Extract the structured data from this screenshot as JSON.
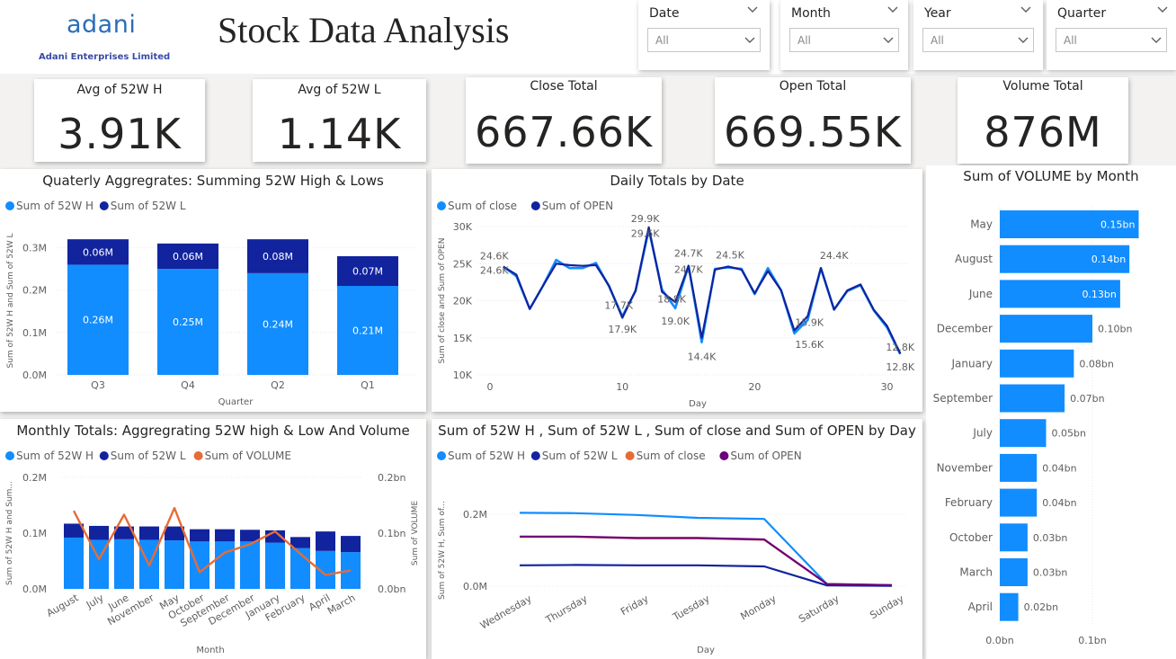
{
  "header": {
    "logo_word": "adani",
    "logo_sub": "Adani Enterprises Limited",
    "title": "Stock Data Analysis"
  },
  "slicers": [
    {
      "name": "Date",
      "value": "All"
    },
    {
      "name": "Month",
      "value": "All"
    },
    {
      "name": "Year",
      "value": "All"
    },
    {
      "name": "Quarter",
      "value": "All"
    }
  ],
  "kpis": [
    {
      "label": "Avg of 52W H",
      "value": "3.91K"
    },
    {
      "label": "Avg of 52W L",
      "value": "1.14K"
    },
    {
      "label": "Close Total",
      "value": "667.66K"
    },
    {
      "label": "Open Total",
      "value": "669.55K"
    },
    {
      "label": "Volume Total",
      "value": "876M"
    }
  ],
  "colors": {
    "light_blue": "#118dff",
    "dark_blue": "#12239e",
    "orange": "#e66c37",
    "purple": "#6b007b",
    "grid": "#e8e8e8",
    "axis_text": "#605e5c"
  },
  "chart_data": [
    {
      "id": "quarterly",
      "type": "bar",
      "title": "Quaterly Aggregrates: Summing 52W High & Lows",
      "legend": [
        "Sum of 52W H",
        "Sum of 52W L"
      ],
      "xlabel": "Quarter",
      "ylabel": "Sum of 52W H and Sum of 52W L",
      "categories": [
        "Q3",
        "Q4",
        "Q2",
        "Q1"
      ],
      "series": [
        {
          "name": "Sum of 52W H",
          "values": [
            0.26,
            0.25,
            0.24,
            0.21
          ],
          "labels": [
            "0.26M",
            "0.25M",
            "0.24M",
            "0.21M"
          ]
        },
        {
          "name": "Sum of 52W L",
          "values": [
            0.06,
            0.06,
            0.08,
            0.07
          ],
          "labels": [
            "0.06M",
            "0.06M",
            "0.08M",
            "0.07M"
          ]
        }
      ],
      "ylim": [
        0,
        0.35
      ],
      "yticks": [
        0,
        0.1,
        0.2,
        0.3
      ],
      "ytick_labels": [
        "0.0M",
        "0.1M",
        "0.2M",
        "0.3M"
      ]
    },
    {
      "id": "daily",
      "type": "line",
      "title": "Daily Totals by Date",
      "legend": [
        "Sum of close",
        "Sum of OPEN"
      ],
      "xlabel": "Day",
      "ylabel": "Sum of close and Sum of OPEN",
      "x": [
        1,
        2,
        3,
        4,
        5,
        6,
        7,
        8,
        9,
        10,
        11,
        12,
        13,
        14,
        15,
        16,
        17,
        18,
        19,
        20,
        21,
        22,
        23,
        24,
        25,
        26,
        27,
        28,
        29,
        30,
        31
      ],
      "series": [
        {
          "name": "Sum of close",
          "values": [
            24.6,
            23.3,
            18.9,
            22.0,
            25.5,
            24.4,
            24.4,
            25.1,
            21.9,
            17.9,
            21.3,
            29.6,
            21.5,
            19.0,
            24.7,
            14.4,
            24.3,
            24.5,
            24.3,
            20.9,
            24.4,
            21.4,
            15.6,
            17.4,
            24.4,
            18.8,
            21.3,
            22.1,
            18.7,
            16.4,
            12.8
          ]
        },
        {
          "name": "Sum of OPEN",
          "values": [
            24.6,
            23.5,
            18.9,
            22.0,
            25.0,
            24.8,
            24.7,
            24.8,
            22.0,
            17.7,
            21.4,
            29.9,
            21.2,
            19.8,
            24.7,
            15.0,
            24.2,
            24.6,
            24.2,
            21.0,
            24.0,
            21.4,
            16.0,
            17.9,
            24.4,
            18.8,
            21.4,
            22.2,
            18.8,
            16.6,
            12.9
          ]
        }
      ],
      "annotations": [
        "24.6K",
        "24.6K",
        "17.7K",
        "17.9K",
        "29.9K",
        "29.6K",
        "18.8K",
        "19.0K",
        "24.7K",
        "24.7K",
        "14.4K",
        "24.5K",
        "15.9K",
        "15.6K",
        "24.4K",
        "12.8K",
        "12.8K"
      ],
      "xlim": [
        0,
        32
      ],
      "xticks": [
        0,
        10,
        20,
        30
      ],
      "ylim": [
        10,
        30
      ],
      "yticks": [
        10,
        15,
        20,
        25,
        30
      ],
      "ytick_labels": [
        "10K",
        "15K",
        "20K",
        "25K",
        "30K"
      ]
    },
    {
      "id": "volume_month",
      "type": "bar",
      "orientation": "horizontal",
      "title": "Sum of VOLUME by Month",
      "categories": [
        "May",
        "August",
        "June",
        "December",
        "January",
        "September",
        "July",
        "November",
        "February",
        "October",
        "March",
        "April"
      ],
      "values": [
        0.15,
        0.14,
        0.13,
        0.1,
        0.08,
        0.07,
        0.05,
        0.04,
        0.04,
        0.03,
        0.03,
        0.02
      ],
      "labels": [
        "0.15bn",
        "0.14bn",
        "0.13bn",
        "0.10bn",
        "0.08bn",
        "0.07bn",
        "0.05bn",
        "0.04bn",
        "0.04bn",
        "0.03bn",
        "0.03bn",
        "0.02bn"
      ],
      "xlim": [
        0,
        0.16
      ],
      "xticks": [
        0,
        0.1
      ],
      "xtick_labels": [
        "0.0bn",
        "0.1bn"
      ]
    },
    {
      "id": "monthly",
      "type": "bar",
      "title": "Monthly Totals: Aggregrating 52W high & Low And Volume",
      "legend": [
        "Sum of 52W H",
        "Sum of 52W L",
        "Sum of VOLUME"
      ],
      "xlabel": "Month",
      "ylabel": "Sum of 52W H and Sum...",
      "y2label": "Sum of VOLUME",
      "categories": [
        "August",
        "July",
        "June",
        "November",
        "May",
        "October",
        "September",
        "December",
        "January",
        "February",
        "April",
        "March"
      ],
      "series": [
        {
          "name": "Sum of 52W H",
          "values": [
            0.092,
            0.088,
            0.089,
            0.088,
            0.087,
            0.085,
            0.085,
            0.085,
            0.083,
            0.073,
            0.068,
            0.066
          ]
        },
        {
          "name": "Sum of 52W L",
          "values": [
            0.025,
            0.025,
            0.023,
            0.024,
            0.025,
            0.022,
            0.022,
            0.021,
            0.022,
            0.02,
            0.035,
            0.029
          ]
        },
        {
          "name": "Sum of VOLUME",
          "axis": "right",
          "values": [
            0.14,
            0.053,
            0.133,
            0.042,
            0.145,
            0.03,
            0.065,
            0.08,
            0.103,
            0.063,
            0.025,
            0.033
          ]
        }
      ],
      "ylim": [
        0,
        0.2
      ],
      "yticks": [
        0,
        0.1,
        0.2
      ],
      "ytick_labels": [
        "0.0M",
        "0.1M",
        "0.2M"
      ],
      "y2lim": [
        0,
        0.2
      ],
      "y2ticks": [
        0,
        0.1,
        0.2
      ],
      "y2tick_labels": [
        "0.0bn",
        "0.1bn",
        "0.2bn"
      ]
    },
    {
      "id": "by_day",
      "type": "line",
      "title": "Sum of 52W H , Sum of 52W L , Sum of close and Sum of OPEN by Day",
      "legend": [
        "Sum of 52W H",
        "Sum of 52W L",
        "Sum of close",
        "Sum of OPEN"
      ],
      "xlabel": "Day",
      "ylabel": "Sum of 52W H, Sum of...",
      "categories": [
        "Wednesday",
        "Thursday",
        "Friday",
        "Tuesday",
        "Monday",
        "Saturday",
        "Sunday"
      ],
      "series": [
        {
          "name": "Sum of 52W H",
          "values": [
            0.204,
            0.203,
            0.198,
            0.19,
            0.187,
            0.005,
            0.002
          ]
        },
        {
          "name": "Sum of 52W L",
          "values": [
            0.058,
            0.059,
            0.058,
            0.058,
            0.055,
            0.002,
            0.001
          ]
        },
        {
          "name": "Sum of close",
          "values": [
            0.137,
            0.137,
            0.133,
            0.133,
            0.129,
            0.006,
            0.003
          ]
        },
        {
          "name": "Sum of OPEN",
          "values": [
            0.138,
            0.138,
            0.134,
            0.134,
            0.13,
            0.006,
            0.003
          ]
        }
      ],
      "ylim": [
        0,
        0.25
      ],
      "yticks": [
        0,
        0.2
      ],
      "ytick_labels": [
        "0.0M",
        "0.2M"
      ]
    }
  ]
}
